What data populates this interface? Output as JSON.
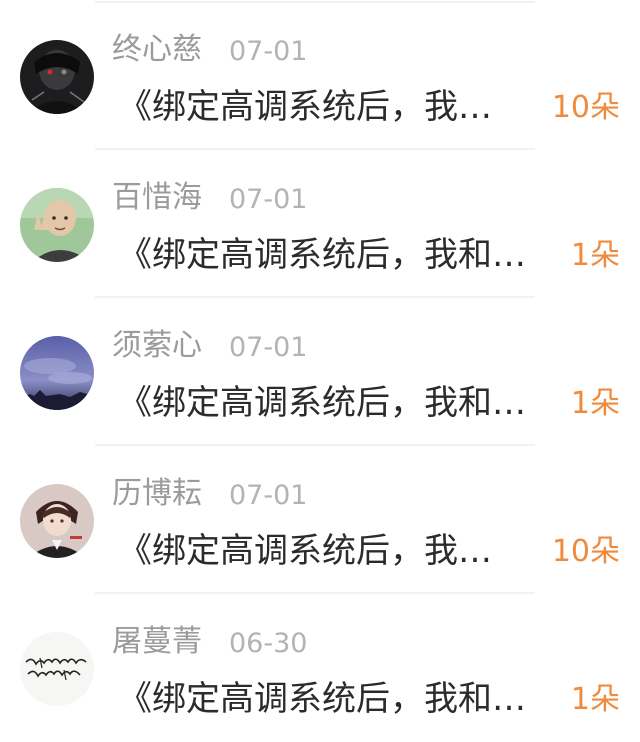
{
  "rows": [
    {
      "name": "终心慈",
      "date": "07-01",
      "message": "《绑定高调系统后，我…",
      "gift": "10朵",
      "avatar": "dark-anime-boy-avatar"
    },
    {
      "name": "百惜海",
      "date": "07-01",
      "message": "《绑定高调系统后，我和…",
      "gift": "1朵",
      "avatar": "bald-man-avatar"
    },
    {
      "name": "须萦心",
      "date": "07-01",
      "message": "《绑定高调系统后，我和…",
      "gift": "1朵",
      "avatar": "night-sky-avatar"
    },
    {
      "name": "历博耘",
      "date": "07-01",
      "message": "《绑定高调系统后，我…",
      "gift": "10朵",
      "avatar": "anime-suit-boy-avatar"
    },
    {
      "name": "屠蔓菁",
      "date": "06-30",
      "message": "《绑定高调系统后，我和…",
      "gift": "1朵",
      "avatar": "calligraphy-avatar"
    }
  ],
  "colors": {
    "name": "#9b9b9b",
    "date": "#b3b3b3",
    "message": "#2b2b2b",
    "gift": "#f08a3c",
    "divider": "#f1f1f1"
  }
}
